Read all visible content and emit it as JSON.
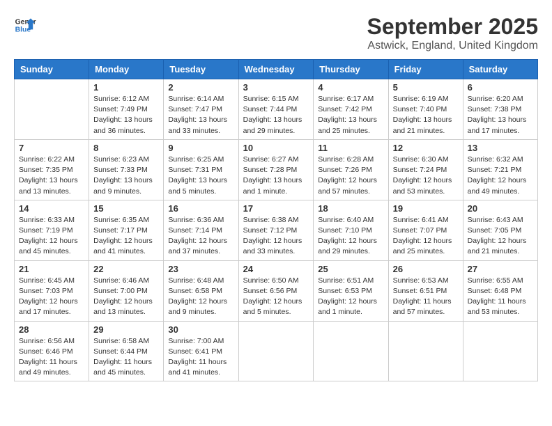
{
  "header": {
    "logo_line1": "General",
    "logo_line2": "Blue",
    "month": "September 2025",
    "location": "Astwick, England, United Kingdom"
  },
  "weekdays": [
    "Sunday",
    "Monday",
    "Tuesday",
    "Wednesday",
    "Thursday",
    "Friday",
    "Saturday"
  ],
  "weeks": [
    [
      {
        "day": "",
        "info": ""
      },
      {
        "day": "1",
        "info": "Sunrise: 6:12 AM\nSunset: 7:49 PM\nDaylight: 13 hours\nand 36 minutes."
      },
      {
        "day": "2",
        "info": "Sunrise: 6:14 AM\nSunset: 7:47 PM\nDaylight: 13 hours\nand 33 minutes."
      },
      {
        "day": "3",
        "info": "Sunrise: 6:15 AM\nSunset: 7:44 PM\nDaylight: 13 hours\nand 29 minutes."
      },
      {
        "day": "4",
        "info": "Sunrise: 6:17 AM\nSunset: 7:42 PM\nDaylight: 13 hours\nand 25 minutes."
      },
      {
        "day": "5",
        "info": "Sunrise: 6:19 AM\nSunset: 7:40 PM\nDaylight: 13 hours\nand 21 minutes."
      },
      {
        "day": "6",
        "info": "Sunrise: 6:20 AM\nSunset: 7:38 PM\nDaylight: 13 hours\nand 17 minutes."
      }
    ],
    [
      {
        "day": "7",
        "info": "Sunrise: 6:22 AM\nSunset: 7:35 PM\nDaylight: 13 hours\nand 13 minutes."
      },
      {
        "day": "8",
        "info": "Sunrise: 6:23 AM\nSunset: 7:33 PM\nDaylight: 13 hours\nand 9 minutes."
      },
      {
        "day": "9",
        "info": "Sunrise: 6:25 AM\nSunset: 7:31 PM\nDaylight: 13 hours\nand 5 minutes."
      },
      {
        "day": "10",
        "info": "Sunrise: 6:27 AM\nSunset: 7:28 PM\nDaylight: 13 hours\nand 1 minute."
      },
      {
        "day": "11",
        "info": "Sunrise: 6:28 AM\nSunset: 7:26 PM\nDaylight: 12 hours\nand 57 minutes."
      },
      {
        "day": "12",
        "info": "Sunrise: 6:30 AM\nSunset: 7:24 PM\nDaylight: 12 hours\nand 53 minutes."
      },
      {
        "day": "13",
        "info": "Sunrise: 6:32 AM\nSunset: 7:21 PM\nDaylight: 12 hours\nand 49 minutes."
      }
    ],
    [
      {
        "day": "14",
        "info": "Sunrise: 6:33 AM\nSunset: 7:19 PM\nDaylight: 12 hours\nand 45 minutes."
      },
      {
        "day": "15",
        "info": "Sunrise: 6:35 AM\nSunset: 7:17 PM\nDaylight: 12 hours\nand 41 minutes."
      },
      {
        "day": "16",
        "info": "Sunrise: 6:36 AM\nSunset: 7:14 PM\nDaylight: 12 hours\nand 37 minutes."
      },
      {
        "day": "17",
        "info": "Sunrise: 6:38 AM\nSunset: 7:12 PM\nDaylight: 12 hours\nand 33 minutes."
      },
      {
        "day": "18",
        "info": "Sunrise: 6:40 AM\nSunset: 7:10 PM\nDaylight: 12 hours\nand 29 minutes."
      },
      {
        "day": "19",
        "info": "Sunrise: 6:41 AM\nSunset: 7:07 PM\nDaylight: 12 hours\nand 25 minutes."
      },
      {
        "day": "20",
        "info": "Sunrise: 6:43 AM\nSunset: 7:05 PM\nDaylight: 12 hours\nand 21 minutes."
      }
    ],
    [
      {
        "day": "21",
        "info": "Sunrise: 6:45 AM\nSunset: 7:03 PM\nDaylight: 12 hours\nand 17 minutes."
      },
      {
        "day": "22",
        "info": "Sunrise: 6:46 AM\nSunset: 7:00 PM\nDaylight: 12 hours\nand 13 minutes."
      },
      {
        "day": "23",
        "info": "Sunrise: 6:48 AM\nSunset: 6:58 PM\nDaylight: 12 hours\nand 9 minutes."
      },
      {
        "day": "24",
        "info": "Sunrise: 6:50 AM\nSunset: 6:56 PM\nDaylight: 12 hours\nand 5 minutes."
      },
      {
        "day": "25",
        "info": "Sunrise: 6:51 AM\nSunset: 6:53 PM\nDaylight: 12 hours\nand 1 minute."
      },
      {
        "day": "26",
        "info": "Sunrise: 6:53 AM\nSunset: 6:51 PM\nDaylight: 11 hours\nand 57 minutes."
      },
      {
        "day": "27",
        "info": "Sunrise: 6:55 AM\nSunset: 6:48 PM\nDaylight: 11 hours\nand 53 minutes."
      }
    ],
    [
      {
        "day": "28",
        "info": "Sunrise: 6:56 AM\nSunset: 6:46 PM\nDaylight: 11 hours\nand 49 minutes."
      },
      {
        "day": "29",
        "info": "Sunrise: 6:58 AM\nSunset: 6:44 PM\nDaylight: 11 hours\nand 45 minutes."
      },
      {
        "day": "30",
        "info": "Sunrise: 7:00 AM\nSunset: 6:41 PM\nDaylight: 11 hours\nand 41 minutes."
      },
      {
        "day": "",
        "info": ""
      },
      {
        "day": "",
        "info": ""
      },
      {
        "day": "",
        "info": ""
      },
      {
        "day": "",
        "info": ""
      }
    ]
  ]
}
